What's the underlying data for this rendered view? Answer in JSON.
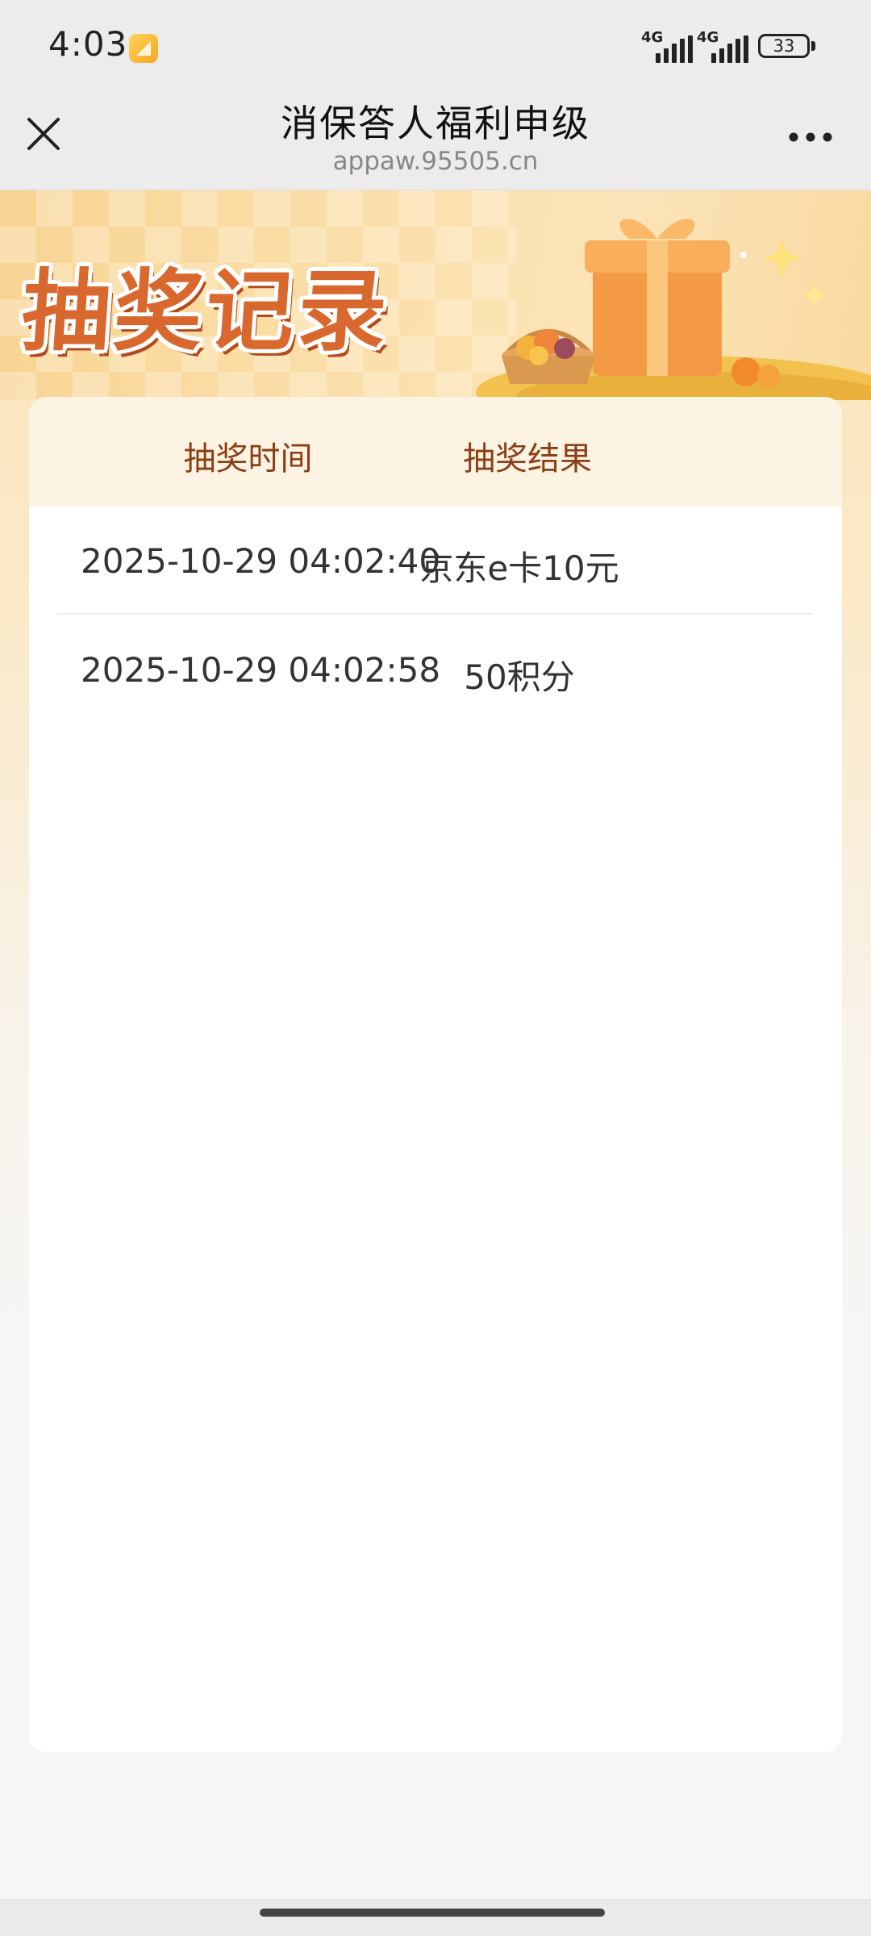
{
  "status_bar": {
    "time": "4:03",
    "network_labels": [
      "4G",
      "4G"
    ],
    "battery": "33"
  },
  "nav": {
    "title": "消保答人福利申级",
    "url": "appaw.95505.cn"
  },
  "banner": {
    "title": "抽奖记录"
  },
  "table": {
    "headers": [
      "抽奖时间",
      "抽奖结果"
    ],
    "rows": [
      {
        "time": "2025-10-29 04:02:40",
        "result": "京东e卡10元"
      },
      {
        "time": "2025-10-29 04:02:58",
        "result": "50积分"
      }
    ]
  },
  "colors": {
    "accent": "#d8682d",
    "header_text": "#8a3f16",
    "header_bg": "#fdf3e2"
  }
}
